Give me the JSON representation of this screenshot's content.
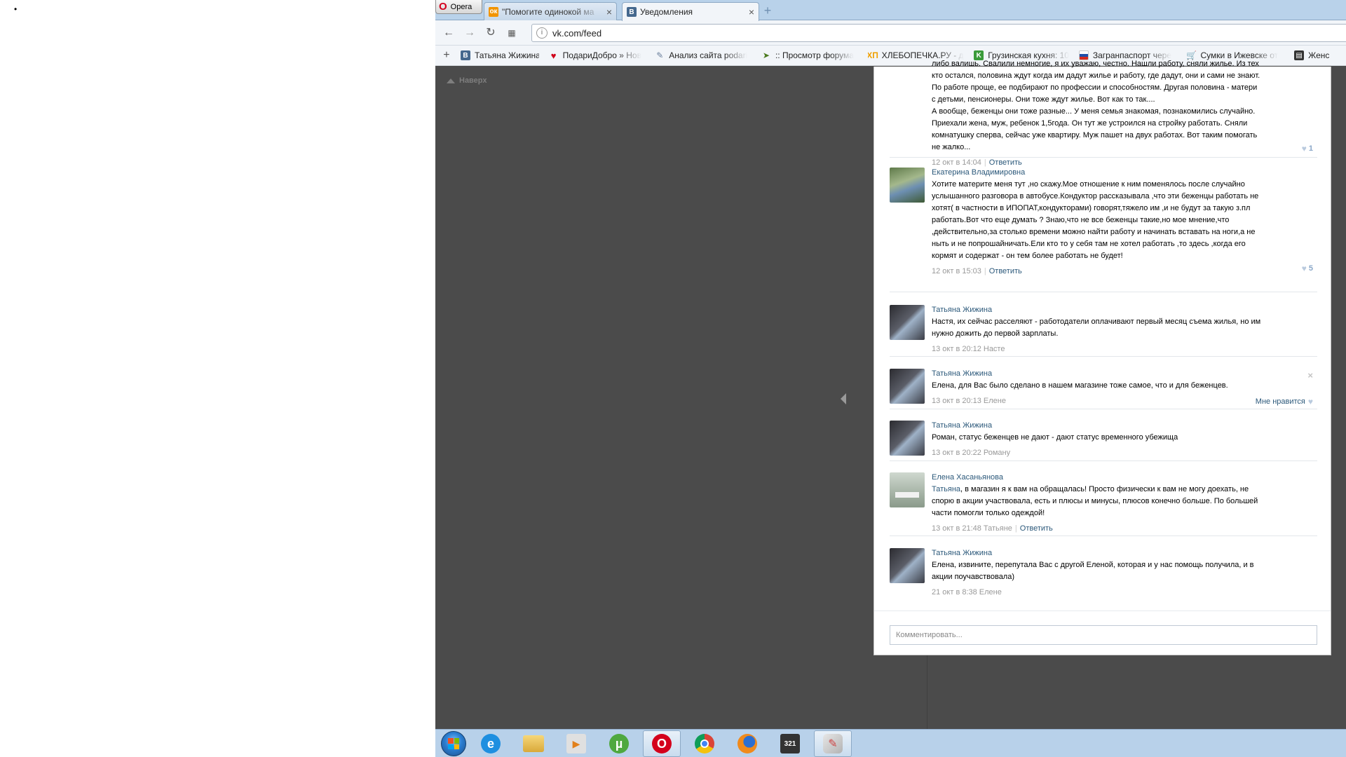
{
  "desktop": {
    "bullet": "•"
  },
  "browser": {
    "menu_label": "Opera",
    "tabs": [
      {
        "title": "\"Помогите одинокой ма",
        "favicon": "odnoklassniki-favicon",
        "close": "×"
      },
      {
        "title": "Уведомления",
        "favicon": "vk-favicon",
        "close": "×"
      }
    ],
    "new_tab": "+",
    "address": "vk.com/feed",
    "bookmarks_add": "+",
    "bookmarks": [
      {
        "label": "Татьяна Жижина",
        "icon": "vk-favicon"
      },
      {
        "label": "ПодариДобро » Нов",
        "icon": "heart-icon"
      },
      {
        "label": "Анализ сайта podari",
        "icon": "analysis-icon"
      },
      {
        "label": ":: Просмотр форума",
        "icon": "forum-icon"
      },
      {
        "label": "ХЛЕБОПЕЧКА.РУ - до",
        "icon": "xp-favicon"
      },
      {
        "label": "Грузинская кухня: 10",
        "icon": "k-favicon"
      },
      {
        "label": "Загранпаспорт чере",
        "icon": "russia-flag-icon"
      },
      {
        "label": "Сумки в Ижевске от",
        "icon": "cart-icon"
      },
      {
        "label": "Женс",
        "icon": "book-icon"
      }
    ]
  },
  "page": {
    "up_link": "Наверх",
    "comments": [
      {
        "author": "",
        "text": "либо валишь. Свалили немногие, я их уважаю, честно. Нашли работу, сняли жилье. Из тех кто остался, половина ждут когда им дадут жилье и работу, где дадут, они и сами не знают. По работе проще, ее подбирают по профессии и способностям. Другая половина - матери с детьми, пенсионеры. Они тоже ждут жилье. Вот как то так....\nА вообще, беженцы они тоже разные... У меня семья знакомая, познакомились случайно. Приехали жена, муж, ребенок 1,5года. Он тут же устроился на стройку работать. Сняли комнатушку сперва, сейчас уже квартиру. Муж пашет на двух работах. Вот таким помогать не жалко...",
        "time": "12 окт в 14:04",
        "reply": "Ответить",
        "likes": "1"
      },
      {
        "author": "Екатерина Владимировна",
        "text": "Хотите материте меня тут ,но скажу.Мое отношение к ним поменялось после случайно услышанного разговора в автобусе.Кондуктор рассказывала ,что эти беженцы работать не хотят( в частности в ИПОПАТ,кондукторами) говорят,тяжело им ,и не будут за такую з.пл работать.Вот что еще думать ? Знаю,что не все беженцы такие,но мое мнение,что ,действительно,за столько времени можно найти работу и начинать вставать на ноги,а не ныть и не попрошайничать.Ели кто то у себя там не хотел работать ,то здесь ,когда его кормят и содержат - он тем более работать не будет!",
        "time": "12 окт в 15:03",
        "reply": "Ответить",
        "likes": "5"
      },
      {
        "author": "Татьяна Жижина",
        "text": "Настя, их сейчас расселяют - работодатели оплачивают первый месяц съема жилья, но им нужно дожить до первой зарплаты.",
        "time": "13 окт в 20:12",
        "to": "Насте"
      },
      {
        "author": "Татьяна Жижина",
        "text": "Елена, для Вас было сделано в нашем магазине тоже самое, что и для беженцев.",
        "time": "13 окт в 20:13",
        "to": "Елене",
        "like_label": "Мне нравится",
        "delete": "×"
      },
      {
        "author": "Татьяна Жижина",
        "text": "Роман, статус беженцев не дают - дают статус временного убежища",
        "time": "13 окт в 20:22",
        "to": "Роману"
      },
      {
        "author": "Елена Хасаньянова",
        "text_link": "Татьяна",
        "text": ", в магазин я к вам на обращалась! Просто физически к вам не могу доехать, не спорю в акции участвовала, есть и плюсы и минусы, плюсов конечно больше. По большей части помогли только одеждой!",
        "time": "13 окт в 21:48",
        "to": "Татьяне",
        "reply": "Ответить"
      },
      {
        "author": "Татьяна Жижина",
        "text": "Елена, извините, перепутала Вас с другой Еленой, которая и у нас помощь получила, и в акции поучавствовала)",
        "time": "21 окт в 8:38",
        "to": "Елене"
      }
    ],
    "comment_placeholder": "Комментировать..."
  },
  "taskbar": {
    "apps": [
      "internet-explorer",
      "explorer",
      "media-player",
      "utorrent",
      "opera",
      "chrome",
      "firefox",
      "media-player-classic",
      "paint"
    ],
    "labels": {
      "utorrent": "µ",
      "opera": "O",
      "mpc": "321"
    }
  }
}
